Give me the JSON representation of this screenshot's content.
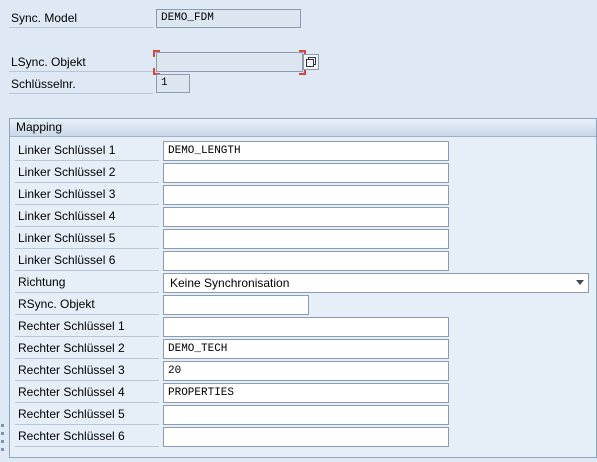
{
  "header": {
    "sync_model_label": "Sync. Model",
    "sync_model_value": "DEMO_FDM",
    "lsync_objekt_label": "LSync. Objekt",
    "lsync_objekt_value": "",
    "schluesselnr_label": "Schlüsselnr.",
    "schluesselnr_value": "1"
  },
  "mapping": {
    "title": "Mapping",
    "left_keys": [
      {
        "label": "Linker Schlüssel 1",
        "value": "DEMO_LENGTH"
      },
      {
        "label": "Linker Schlüssel 2",
        "value": ""
      },
      {
        "label": "Linker Schlüssel 3",
        "value": ""
      },
      {
        "label": "Linker Schlüssel 4",
        "value": ""
      },
      {
        "label": "Linker Schlüssel 5",
        "value": ""
      },
      {
        "label": "Linker Schlüssel 6",
        "value": ""
      }
    ],
    "richtung_label": "Richtung",
    "richtung_value": "Keine Synchronisation",
    "rsync_label": "RSync. Objekt",
    "rsync_value": "",
    "right_keys": [
      {
        "label": "Rechter Schlüssel 1",
        "value": ""
      },
      {
        "label": "Rechter Schlüssel 2",
        "value": "DEMO_TECH"
      },
      {
        "label": "Rechter Schlüssel 3",
        "value": "20"
      },
      {
        "label": "Rechter Schlüssel 4",
        "value": "PROPERTIES"
      },
      {
        "label": "Rechter Schlüssel 5",
        "value": ""
      },
      {
        "label": "Rechter Schlüssel 6",
        "value": ""
      }
    ]
  },
  "icons": {
    "f4_help": "value-help-icon",
    "dropdown": "chevron-down-icon"
  }
}
